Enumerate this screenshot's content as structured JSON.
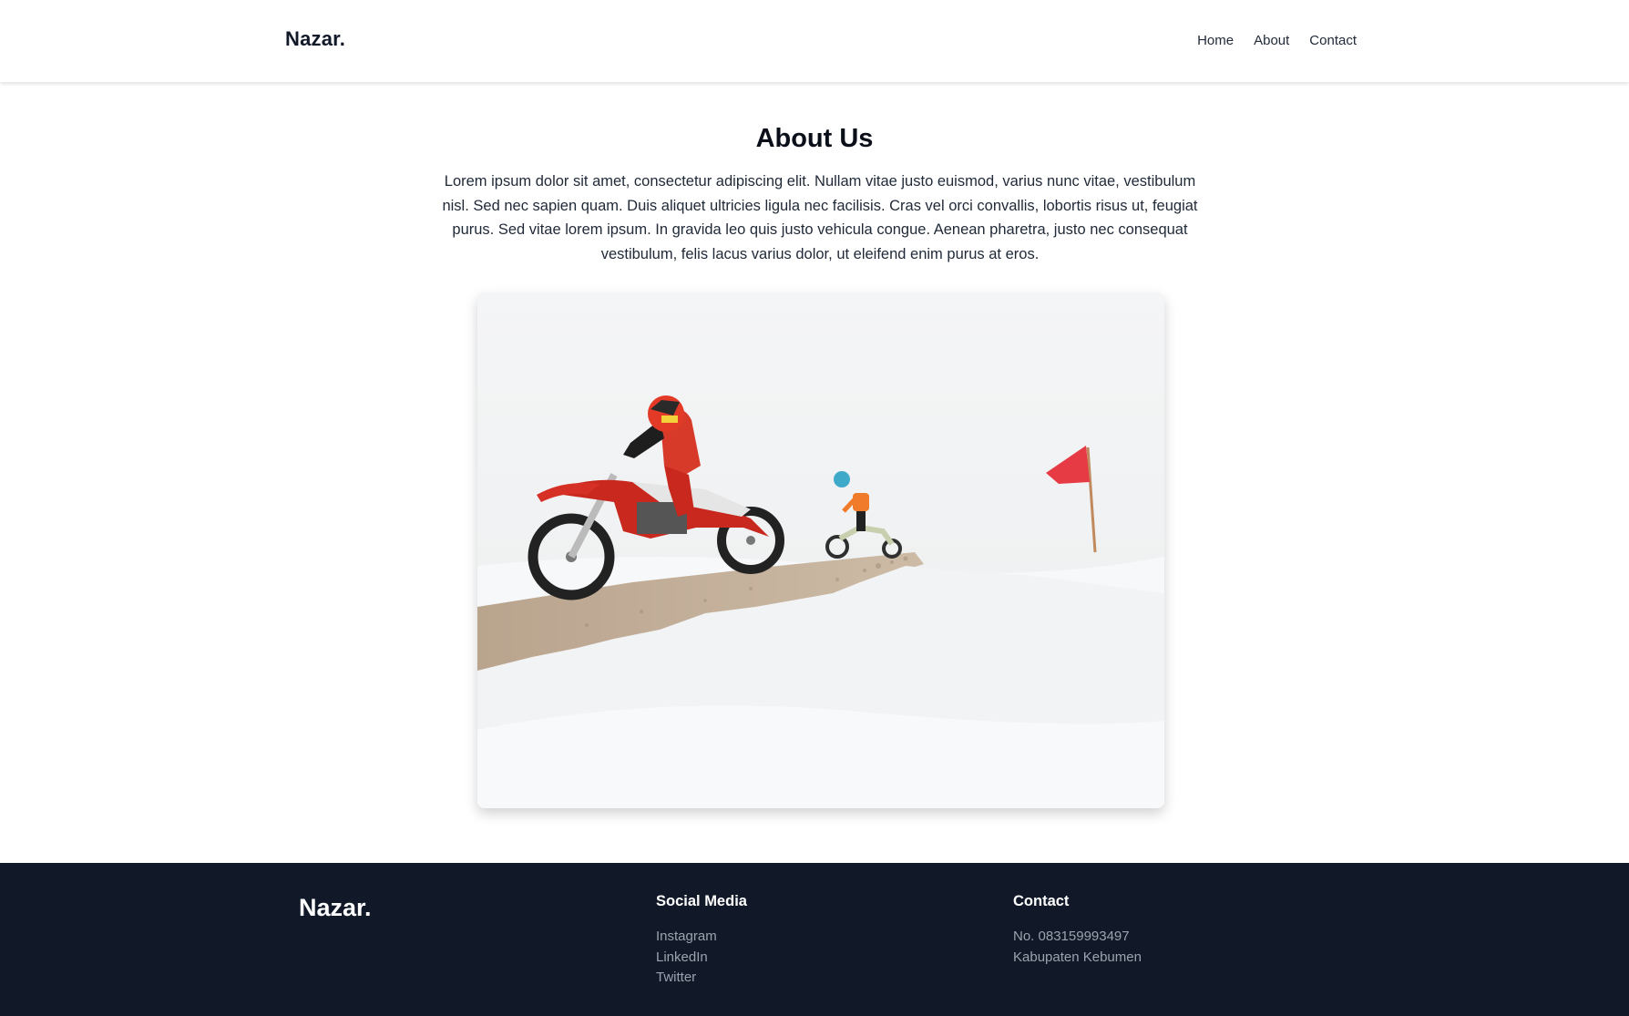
{
  "header": {
    "brand": "Nazar.",
    "nav": [
      "Home",
      "About",
      "Contact"
    ]
  },
  "about": {
    "title": "About Us",
    "description": "Lorem ipsum dolor sit amet, consectetur adipiscing elit. Nullam vitae justo euismod, varius nunc vitae, vestibulum nisl. Sed nec sapien quam. Duis aliquet ultricies ligula nec facilisis. Cras vel orci convallis, lobortis risus ut, feugiat purus. Sed vitae lorem ipsum. In gravida leo quis justo vehicula congue. Aenean pharetra, justo nec consequat vestibulum, felis lacus varius dolor, ut eleifend enim purus at eros.",
    "image": "motocross-in-snow-photo"
  },
  "footer": {
    "brand": "Nazar.",
    "social": {
      "heading": "Social Media",
      "links": [
        "Instagram",
        "LinkedIn",
        "Twitter"
      ]
    },
    "contact": {
      "heading": "Contact",
      "phone": "No. 083159993497",
      "address": "Kabupaten Kebumen"
    }
  },
  "colors": {
    "footer_bg": "#111827",
    "text_dark": "#111827",
    "footer_muted": "#9ca3af",
    "flag": "#e63a45",
    "bike_red": "#c8281e"
  }
}
